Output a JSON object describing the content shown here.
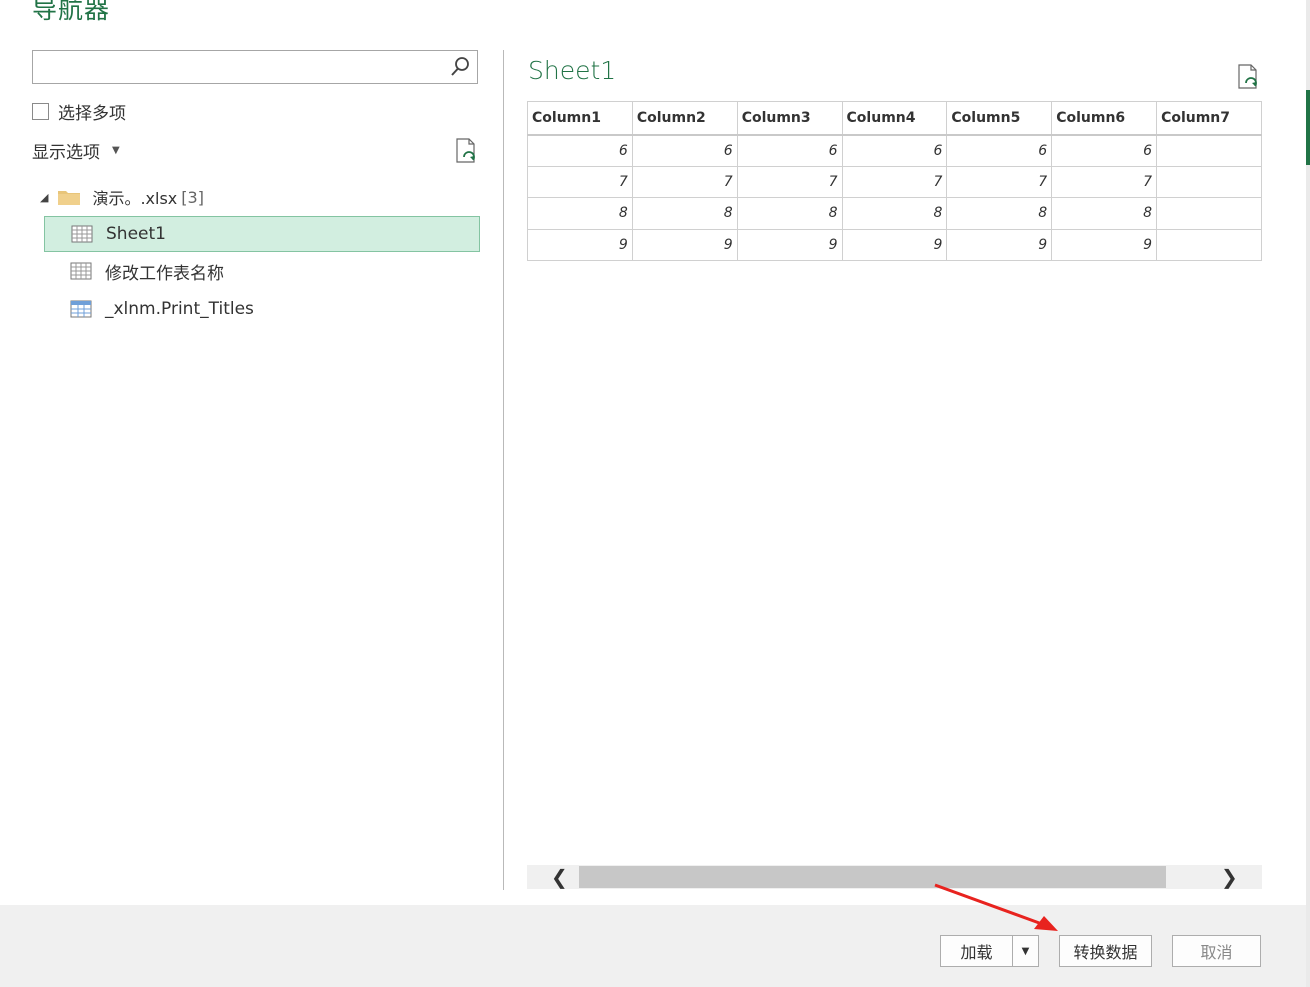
{
  "dialog": {
    "title": "导航器"
  },
  "left": {
    "search": {
      "value": "",
      "placeholder": ""
    },
    "multi_select": {
      "label": "选择多项",
      "checked": false
    },
    "display_options": {
      "label": "显示选项"
    },
    "tree": {
      "root": {
        "name": "演示。.xlsx",
        "count": "[3]"
      },
      "items": [
        {
          "label": "Sheet1",
          "selected": true,
          "icon": "worksheet-icon"
        },
        {
          "label": "修改工作表名称",
          "selected": false,
          "icon": "worksheet-icon"
        },
        {
          "label": "_xlnm.Print_Titles",
          "selected": false,
          "icon": "named-range-icon"
        }
      ]
    }
  },
  "preview": {
    "title": "Sheet1",
    "columns": [
      "Column1",
      "Column2",
      "Column3",
      "Column4",
      "Column5",
      "Column6",
      "Column7"
    ],
    "rows": [
      [
        "6",
        "6",
        "6",
        "6",
        "6",
        "6",
        ""
      ],
      [
        "7",
        "7",
        "7",
        "7",
        "7",
        "7",
        ""
      ],
      [
        "8",
        "8",
        "8",
        "8",
        "8",
        "8",
        ""
      ],
      [
        "9",
        "9",
        "9",
        "9",
        "9",
        "9",
        ""
      ]
    ]
  },
  "footer": {
    "load_label": "加载",
    "transform_label": "转换数据",
    "cancel_label": "取消"
  },
  "colors": {
    "accent": "#217346",
    "selected_bg": "#d2eee0",
    "annotation_arrow": "#e8231f"
  }
}
